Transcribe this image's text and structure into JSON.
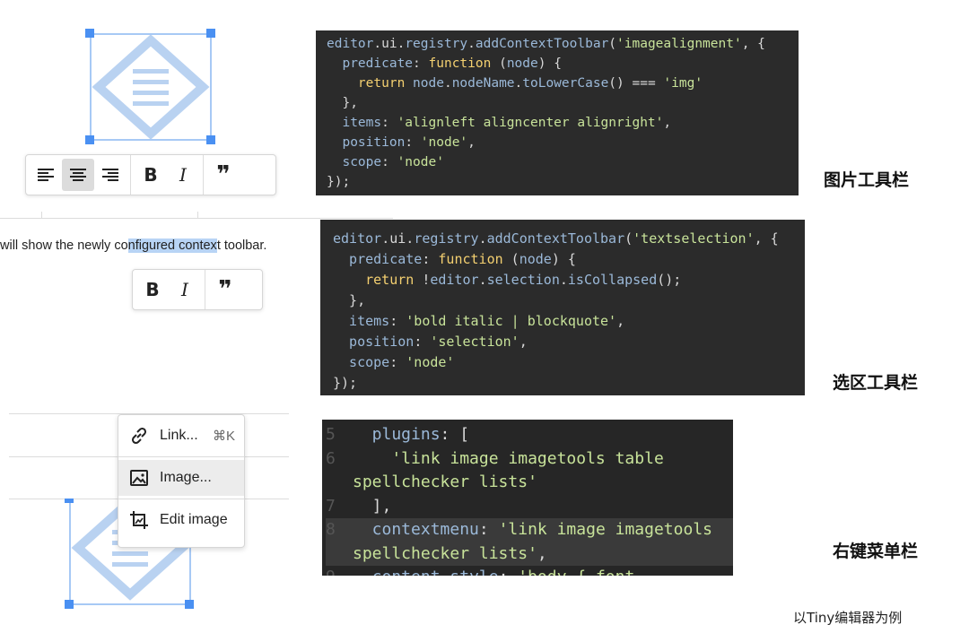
{
  "code_image": {
    "lines": [
      [
        {
          "t": "editor",
          "c": "k-prop"
        },
        {
          "t": ".ui.",
          "c": "k-plain"
        },
        {
          "t": "registry",
          "c": "k-prop"
        },
        {
          "t": ".",
          "c": "k-plain"
        },
        {
          "t": "addContextToolbar",
          "c": "k-prop"
        },
        {
          "t": "(",
          "c": "k-plain"
        },
        {
          "t": "'imagealignment'",
          "c": "k-str"
        },
        {
          "t": ", {",
          "c": "k-plain"
        }
      ],
      [
        {
          "t": "  predicate",
          "c": "k-prop"
        },
        {
          "t": ": ",
          "c": "k-plain"
        },
        {
          "t": "function",
          "c": "k-kw"
        },
        {
          "t": " (",
          "c": "k-plain"
        },
        {
          "t": "node",
          "c": "k-prop"
        },
        {
          "t": ") {",
          "c": "k-plain"
        }
      ],
      [
        {
          "t": "    return ",
          "c": "k-kw"
        },
        {
          "t": "node",
          "c": "k-prop"
        },
        {
          "t": ".",
          "c": "k-plain"
        },
        {
          "t": "nodeName",
          "c": "k-prop"
        },
        {
          "t": ".",
          "c": "k-plain"
        },
        {
          "t": "toLowerCase",
          "c": "k-prop"
        },
        {
          "t": "() === ",
          "c": "k-plain"
        },
        {
          "t": "'img'",
          "c": "k-str"
        }
      ],
      [
        {
          "t": "  },",
          "c": "k-plain"
        }
      ],
      [
        {
          "t": "  items",
          "c": "k-prop"
        },
        {
          "t": ": ",
          "c": "k-plain"
        },
        {
          "t": "'alignleft aligncenter alignright'",
          "c": "k-str"
        },
        {
          "t": ",",
          "c": "k-plain"
        }
      ],
      [
        {
          "t": "  position",
          "c": "k-prop"
        },
        {
          "t": ": ",
          "c": "k-plain"
        },
        {
          "t": "'node'",
          "c": "k-str"
        },
        {
          "t": ",",
          "c": "k-plain"
        }
      ],
      [
        {
          "t": "  scope",
          "c": "k-prop"
        },
        {
          "t": ": ",
          "c": "k-plain"
        },
        {
          "t": "'node'",
          "c": "k-str"
        }
      ],
      [
        {
          "t": "});",
          "c": "k-plain"
        }
      ]
    ]
  },
  "code_selection": {
    "lines": [
      [
        {
          "t": "editor",
          "c": "k-prop"
        },
        {
          "t": ".ui.",
          "c": "k-plain"
        },
        {
          "t": "registry",
          "c": "k-prop"
        },
        {
          "t": ".",
          "c": "k-plain"
        },
        {
          "t": "addContextToolbar",
          "c": "k-prop"
        },
        {
          "t": "(",
          "c": "k-plain"
        },
        {
          "t": "'textselection'",
          "c": "k-str"
        },
        {
          "t": ", {",
          "c": "k-plain"
        }
      ],
      [
        {
          "t": "  predicate",
          "c": "k-prop"
        },
        {
          "t": ": ",
          "c": "k-plain"
        },
        {
          "t": "function",
          "c": "k-kw"
        },
        {
          "t": " (",
          "c": "k-plain"
        },
        {
          "t": "node",
          "c": "k-prop"
        },
        {
          "t": ") {",
          "c": "k-plain"
        }
      ],
      [
        {
          "t": "    return ",
          "c": "k-kw"
        },
        {
          "t": "!",
          "c": "k-plain"
        },
        {
          "t": "editor",
          "c": "k-prop"
        },
        {
          "t": ".",
          "c": "k-plain"
        },
        {
          "t": "selection",
          "c": "k-prop"
        },
        {
          "t": ".",
          "c": "k-plain"
        },
        {
          "t": "isCollapsed",
          "c": "k-prop"
        },
        {
          "t": "();",
          "c": "k-plain"
        }
      ],
      [
        {
          "t": "  },",
          "c": "k-plain"
        }
      ],
      [
        {
          "t": "  items",
          "c": "k-prop"
        },
        {
          "t": ": ",
          "c": "k-plain"
        },
        {
          "t": "'bold italic | blockquote'",
          "c": "k-str"
        },
        {
          "t": ",",
          "c": "k-plain"
        }
      ],
      [
        {
          "t": "  position",
          "c": "k-prop"
        },
        {
          "t": ": ",
          "c": "k-plain"
        },
        {
          "t": "'selection'",
          "c": "k-str"
        },
        {
          "t": ",",
          "c": "k-plain"
        }
      ],
      [
        {
          "t": "  scope",
          "c": "k-prop"
        },
        {
          "t": ": ",
          "c": "k-plain"
        },
        {
          "t": "'node'",
          "c": "k-str"
        }
      ],
      [
        {
          "t": "});",
          "c": "k-plain"
        }
      ]
    ]
  },
  "code_contextmenu": {
    "lines": [
      {
        "num": "5",
        "segs": [
          {
            "t": "  plugins",
            "c": "k-prop"
          },
          {
            "t": ": [",
            "c": "k-plain"
          }
        ]
      },
      {
        "num": "6",
        "segs": [
          {
            "t": "    'link image imagetools table",
            "c": "k-str"
          }
        ]
      },
      {
        "num": "",
        "segs": [
          {
            "t": "spellchecker lists'",
            "c": "k-str"
          }
        ]
      },
      {
        "num": "7",
        "segs": [
          {
            "t": "  ],",
            "c": "k-plain"
          }
        ]
      },
      {
        "num": "8",
        "segs": [
          {
            "t": "  contextmenu",
            "c": "k-prop"
          },
          {
            "t": ": ",
            "c": "k-plain"
          },
          {
            "t": "'link image imagetools",
            "c": "k-str"
          }
        ]
      },
      {
        "num": "",
        "segs": [
          {
            "t": "spellchecker lists'",
            "c": "k-str"
          },
          {
            "t": ",",
            "c": "k-plain"
          }
        ]
      },
      {
        "num": "9",
        "segs": [
          {
            "t": "  content_style",
            "c": "k-prop"
          },
          {
            "t": ": ",
            "c": "k-plain"
          },
          {
            "t": "'body { font",
            "c": "k-str"
          }
        ]
      }
    ]
  },
  "labels": {
    "image_toolbar": "图片工具栏",
    "selection_toolbar": "选区工具栏",
    "context_menu": "右键菜单栏",
    "footer": "以Tiny编辑器为例"
  },
  "editor_text": {
    "before": "will show the newly co",
    "highlight": "nfigured contex",
    "after": "t toolbar."
  },
  "toolbar_image": {
    "buttons": [
      "align-left",
      "align-center",
      "align-right",
      "bold",
      "italic",
      "blockquote"
    ],
    "active": "align-center",
    "bold_glyph": "B",
    "italic_glyph": "I",
    "quote_glyph": "❞"
  },
  "toolbar_selection": {
    "bold_glyph": "B",
    "italic_glyph": "I",
    "quote_glyph": "❞"
  },
  "context_menu": {
    "items": [
      {
        "icon": "link-icon",
        "label": "Link...",
        "shortcut": "⌘K"
      },
      {
        "icon": "image-icon",
        "label": "Image...",
        "shortcut": ""
      },
      {
        "icon": "edit-image-icon",
        "label": "Edit image",
        "shortcut": ""
      }
    ]
  },
  "colors": {
    "code_bg": "#2b2b2b",
    "handle": "#4a90f2",
    "selection_highlight": "#b8d4f5"
  }
}
